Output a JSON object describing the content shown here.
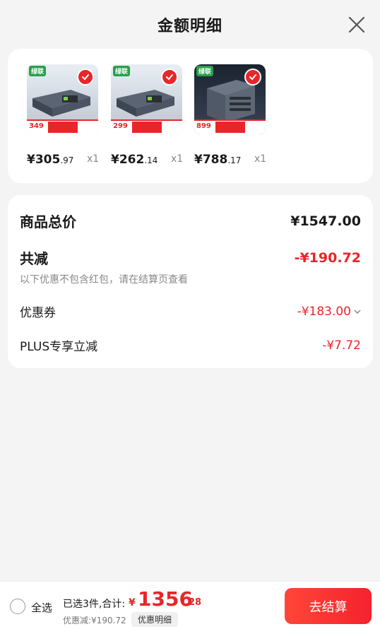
{
  "header": {
    "title": "金额明细"
  },
  "products": [
    {
      "brand": "绿联",
      "thumb_price": "349",
      "price_int": "¥305",
      "price_dec": ".97",
      "qty": "x1"
    },
    {
      "brand": "绿联",
      "thumb_price": "299",
      "price_int": "¥262",
      "price_dec": ".14",
      "qty": "x1"
    },
    {
      "brand": "绿联",
      "thumb_price": "899",
      "price_int": "¥788",
      "price_dec": ".17",
      "qty": "x1"
    }
  ],
  "summary": {
    "goods_total_label": "商品总价",
    "goods_total_value": "¥1547.00",
    "total_reduce_label": "共减",
    "total_reduce_value": "-¥190.72",
    "note": "以下优惠不包含红包，请在结算页查看",
    "coupon_label": "优惠券",
    "coupon_value": "-¥183.00",
    "plus_label": "PLUS专享立减",
    "plus_value": "-¥7.72"
  },
  "bottom": {
    "select_all": "全选",
    "selected_info": "已选3件,合计:",
    "total_symbol": "¥",
    "total_int": "1356",
    "total_dec": ".28",
    "discount_line": "优惠减:¥190.72",
    "detail_chip": "优惠明细",
    "checkout": "去结算"
  },
  "colors": {
    "accent_red": "#e8262a",
    "brand_green": "#27a146"
  }
}
